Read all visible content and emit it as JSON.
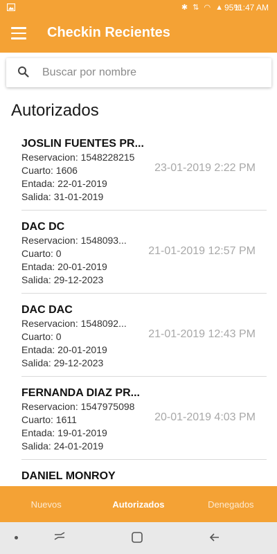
{
  "status_bar": {
    "time": "11:47 AM",
    "battery": "95%"
  },
  "app_bar": {
    "title": "Checkin Recientes",
    "menu_icon": "hamburger-menu-icon"
  },
  "search": {
    "placeholder": "Buscar por nombre",
    "value": ""
  },
  "section_title": "Autorizados",
  "items": [
    {
      "name": "JOSLIN FUENTES PR...",
      "reservation": "Reservacion: 1548228215",
      "room": "Cuarto: 1606",
      "checkin": "Entada: 22-01-2019",
      "checkout": "Salida: 31-01-2019",
      "datetime": "23-01-2019 2:22 PM"
    },
    {
      "name": "DAC DC",
      "reservation": "Reservacion: 1548093...",
      "room": "Cuarto: 0",
      "checkin": "Entada: 20-01-2019",
      "checkout": "Salida: 29-12-2023",
      "datetime": "21-01-2019 12:57 PM"
    },
    {
      "name": "DAC DAC",
      "reservation": "Reservacion: 1548092...",
      "room": "Cuarto: 0",
      "checkin": "Entada: 20-01-2019",
      "checkout": "Salida: 29-12-2023",
      "datetime": "21-01-2019 12:43 PM"
    },
    {
      "name": "FERNANDA DIAZ PR...",
      "reservation": "Reservacion: 1547975098",
      "room": "Cuarto: 1611",
      "checkin": "Entada: 19-01-2019",
      "checkout": "Salida: 24-01-2019",
      "datetime": "20-01-2019 4:03 PM"
    },
    {
      "name": "DANIEL MONROY",
      "reservation": "",
      "room": "",
      "checkin": "",
      "checkout": "",
      "datetime": ""
    }
  ],
  "tabs": [
    {
      "label": "Nuevos",
      "active": false
    },
    {
      "label": "Autorizados",
      "active": true
    },
    {
      "label": "Denegados",
      "active": false
    }
  ],
  "colors": {
    "accent": "#f4a235",
    "date_text": "#a8a8a8",
    "nav_bar": "#e9e9e9"
  }
}
